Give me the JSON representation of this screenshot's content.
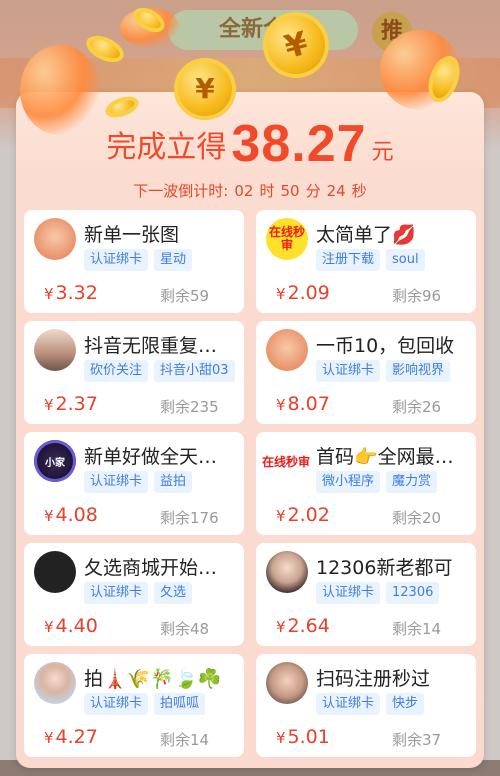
{
  "background": {
    "pill_text": "全新合作",
    "pill2_text": "推"
  },
  "headline": {
    "prefix": "完成立得",
    "amount": "38.27",
    "unit": "元"
  },
  "countdown": {
    "label": "下一波倒计时:",
    "hours": "02",
    "h_unit": "时",
    "minutes": "50",
    "m_unit": "分",
    "seconds": "24",
    "s_unit": "秒"
  },
  "coin_symbol": "¥",
  "tasks": [
    {
      "title": "新单一张图",
      "tags": [
        "认证绑卡",
        "星动"
      ],
      "price": "3.32",
      "remain": "剩余59",
      "avatar": "av-peach",
      "avatar_text": ""
    },
    {
      "title": "太简单了💋",
      "tags": [
        "注册下载",
        "soul"
      ],
      "price": "2.09",
      "remain": "剩余96",
      "avatar": "av-live",
      "avatar_text": "在线秒审"
    },
    {
      "title": "抖音无限重复…",
      "tags": [
        "砍价关注",
        "抖音小甜03"
      ],
      "price": "2.37",
      "remain": "剩余235",
      "avatar": "av-photo1",
      "avatar_text": ""
    },
    {
      "title": "一币10，包回收",
      "tags": [
        "认证绑卡",
        "影响视界"
      ],
      "price": "8.07",
      "remain": "剩余26",
      "avatar": "av-peach",
      "avatar_text": ""
    },
    {
      "title": "新单好做全天…",
      "tags": [
        "认证绑卡",
        "益拍"
      ],
      "price": "4.08",
      "remain": "剩余176",
      "avatar": "av-dark",
      "avatar_text": "小家"
    },
    {
      "title": "首码👉全网最…",
      "tags": [
        "微小程序",
        "魔力赏"
      ],
      "price": "2.02",
      "remain": "剩余20",
      "avatar": "av-text",
      "avatar_text": "在线秒审"
    },
    {
      "title": "夂选商城开始…",
      "tags": [
        "认证绑卡",
        "夂选"
      ],
      "price": "4.40",
      "remain": "剩余48",
      "avatar": "av-duck",
      "avatar_text": ""
    },
    {
      "title": "12306新老都可",
      "tags": [
        "认证绑卡",
        "12306"
      ],
      "price": "2.64",
      "remain": "剩余14",
      "avatar": "av-girl",
      "avatar_text": ""
    },
    {
      "title": "拍🗼🌾🎋🍃☘️",
      "tags": [
        "认证绑卡",
        "拍呱呱"
      ],
      "price": "4.27",
      "remain": "剩余14",
      "avatar": "av-girl2",
      "avatar_text": ""
    },
    {
      "title": "扫码注册秒过",
      "tags": [
        "认证绑卡",
        "快步"
      ],
      "price": "5.01",
      "remain": "剩余37",
      "avatar": "av-girl3",
      "avatar_text": ""
    }
  ],
  "colors": {
    "accent": "#f04a2a",
    "tag_text": "#3f7de0",
    "tag_bg": "#e9f2ff",
    "panel_bg": "#fbdcd0"
  }
}
